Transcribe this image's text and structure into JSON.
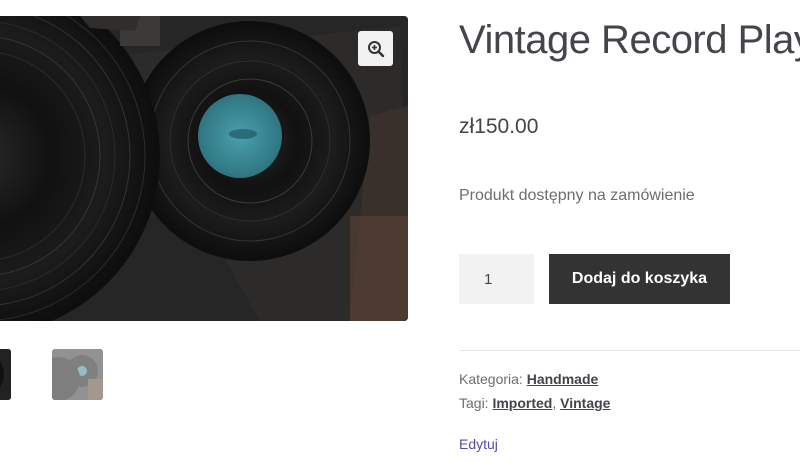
{
  "product": {
    "title": "Vintage Record Player",
    "price": "zł150.00",
    "availability": "Produkt dostępny na zamówienie"
  },
  "cart": {
    "quantity": "1",
    "add_to_cart_label": "Dodaj do koszyka"
  },
  "meta": {
    "category_label": "Kategoria:",
    "category": "Handmade",
    "tags_label": "Tagi:",
    "tags": [
      "Imported",
      "Vintage"
    ],
    "tag_separator": ","
  },
  "edit_label": "Edytuj",
  "gallery": {
    "zoom_icon": "zoom-in-icon"
  },
  "colors": {
    "button": "#333333",
    "edit_link": "#5a4b9e",
    "record_label": "#3b8a96"
  }
}
